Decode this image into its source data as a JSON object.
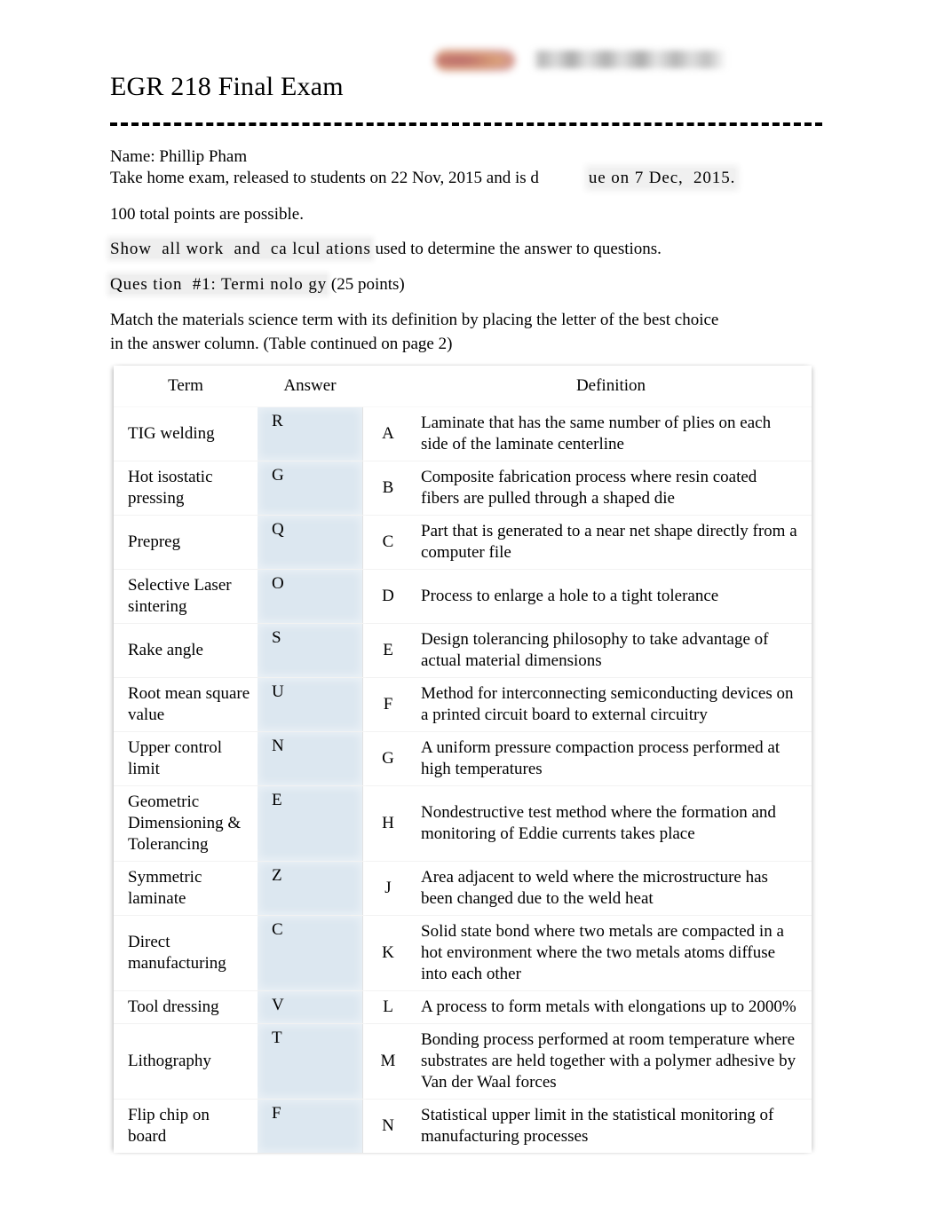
{
  "document": {
    "title": "EGR 218 Final Exam",
    "logo": {
      "mark_alt": "redacted-logo-mark",
      "wordmark_alt": "redacted-logo-wordmark"
    },
    "name_line": "Name: Phillip Pham",
    "take_home_line_part1": "Take home exam, released to students on 22 Nov, 2015 and is d",
    "take_home_line_part2": "ue on 7 Dec,  2015.",
    "points_line": "100 total points are possible.",
    "show_work_highlight": "Show  all work  and  ca lcul ations",
    "show_work_rest": " used to determine the answer to questions.",
    "question_heading_highlight": "Ques tion  #1: Termi nolo gy",
    "question_heading_rest": " (25 points)",
    "instructions": "Match the materials science term with its definition by placing the letter of the best choice in the answer column. (Table continued on page 2)"
  },
  "table": {
    "headers": {
      "term": "Term",
      "answer": "Answer",
      "definition": "Definition"
    },
    "rows": [
      {
        "term": "TIG welding",
        "answer": "R",
        "letter": "A",
        "definition": "Laminate that has the same number of plies on each side of the laminate centerline"
      },
      {
        "term": "Hot isostatic pressing",
        "answer": "G",
        "letter": "B",
        "definition": "Composite fabrication process where resin coated fibers are pulled through a shaped die"
      },
      {
        "term": "Prepreg",
        "answer": "Q",
        "letter": "C",
        "definition": "Part that is generated to a near net shape directly from a computer file"
      },
      {
        "term": "Selective Laser sintering",
        "answer": "O",
        "letter": "D",
        "definition": "Process to enlarge a hole to a tight tolerance"
      },
      {
        "term": "Rake angle",
        "answer": "S",
        "letter": "E",
        "definition": "Design tolerancing philosophy to take advantage of actual material dimensions"
      },
      {
        "term": "Root mean square value",
        "answer": "U",
        "letter": "F",
        "definition": "Method for interconnecting semiconducting devices on a printed circuit board to external circuitry"
      },
      {
        "term": "Upper control limit",
        "answer": "N",
        "letter": "G",
        "definition": "A uniform pressure compaction process performed at high temperatures"
      },
      {
        "term": "Geometric Dimensioning & Tolerancing",
        "answer": "E",
        "letter": "H",
        "definition": "Nondestructive test method where the formation and monitoring of Eddie currents takes place"
      },
      {
        "term": "Symmetric laminate",
        "answer": "Z",
        "letter": "J",
        "definition": "Area adjacent to weld where the microstructure has been changed due to the weld heat"
      },
      {
        "term": "Direct manufacturing",
        "answer": "C",
        "letter": "K",
        "definition": "Solid state bond where two metals are compacted in a hot environment where the two metals atoms diffuse into each other"
      },
      {
        "term": "Tool dressing",
        "answer": "V",
        "letter": "L",
        "definition": "A process to form metals with elongations up to 2000%"
      },
      {
        "term": "Lithography",
        "answer": "T",
        "letter": "M",
        "definition": "Bonding process performed at room temperature where substrates are held together with a polymer adhesive by Van der Waal forces"
      },
      {
        "term": "Flip chip on board",
        "answer": "F",
        "letter": "N",
        "definition": "Statistical upper limit in the statistical monitoring of manufacturing processes"
      }
    ]
  },
  "colors": {
    "answer_column_fill": "#dce7f0",
    "highlight_fill": "#eeeeee",
    "text": "#000000",
    "rule": "#000000"
  }
}
